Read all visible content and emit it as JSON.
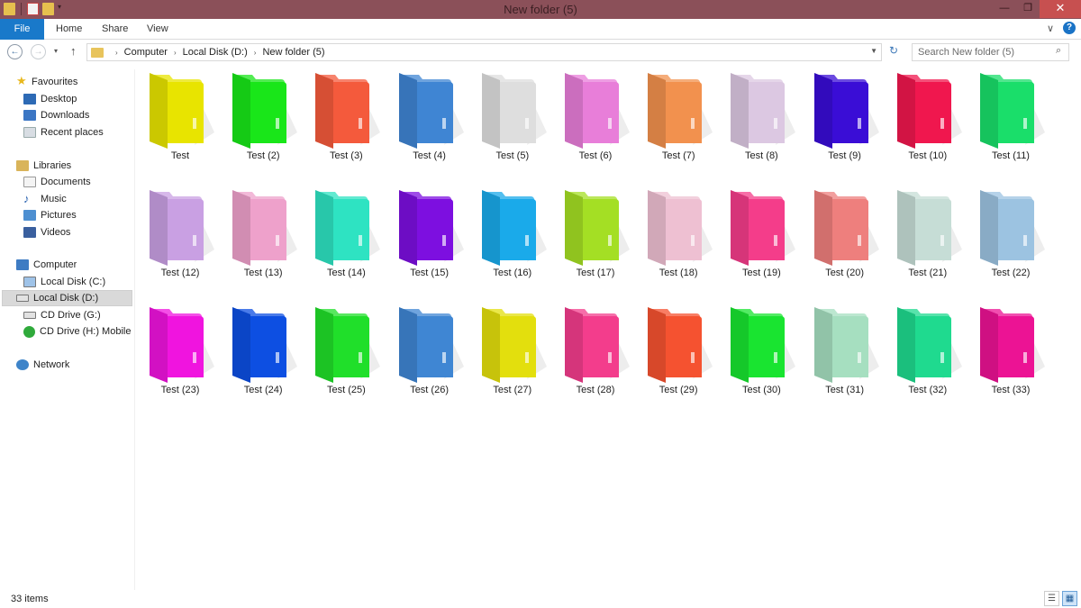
{
  "window": {
    "title": "New folder (5)",
    "minimize_glyph": "—",
    "restore_glyph": "❐",
    "close_glyph": "✕"
  },
  "ribbon": {
    "tabs": [
      "File",
      "Home",
      "Share",
      "View"
    ],
    "help_glyph": "?",
    "expand_glyph": "∨"
  },
  "address": {
    "back_glyph": "←",
    "forward_glyph": "→",
    "recent_glyph": "▾",
    "up_glyph": "↑",
    "crumbs": [
      "Computer",
      "Local Disk (D:)",
      "New folder (5)"
    ],
    "separator_glyph": "›",
    "dropdown_glyph": "⌵",
    "refresh_glyph": "↻"
  },
  "search": {
    "placeholder": "Search New folder (5)",
    "icon_glyph": "⌕"
  },
  "nav_pane": {
    "favourites": {
      "label": "Favourites",
      "items": [
        "Desktop",
        "Downloads",
        "Recent places"
      ]
    },
    "libraries": {
      "label": "Libraries",
      "items": [
        "Documents",
        "Music",
        "Pictures",
        "Videos"
      ]
    },
    "computer": {
      "label": "Computer",
      "items": [
        "Local Disk (C:)",
        "Local Disk (D:)",
        "CD Drive (G:)",
        "CD Drive (H:) Mobile P"
      ]
    },
    "network": {
      "label": "Network"
    },
    "selected": "Local Disk (D:)"
  },
  "folders": [
    {
      "name": "Test",
      "color": "#e8e400"
    },
    {
      "name": "Test (2)",
      "color": "#19e619"
    },
    {
      "name": "Test (3)",
      "color": "#f45a3c"
    },
    {
      "name": "Test (4)",
      "color": "#3f85d3"
    },
    {
      "name": "Test (5)",
      "color": "#dedede"
    },
    {
      "name": "Test (6)",
      "color": "#e87ed9"
    },
    {
      "name": "Test (7)",
      "color": "#f2914e"
    },
    {
      "name": "Test (8)",
      "color": "#dcc8e2"
    },
    {
      "name": "Test (9)",
      "color": "#3a0dd6"
    },
    {
      "name": "Test (10)",
      "color": "#f0174e"
    },
    {
      "name": "Test (11)",
      "color": "#1ade6a"
    },
    {
      "name": "Test (12)",
      "color": "#c9a0e3"
    },
    {
      "name": "Test (13)",
      "color": "#eea1cb"
    },
    {
      "name": "Test (14)",
      "color": "#2ee3c2"
    },
    {
      "name": "Test (15)",
      "color": "#7d0fe0"
    },
    {
      "name": "Test (16)",
      "color": "#1aaaea"
    },
    {
      "name": "Test (17)",
      "color": "#a4df24"
    },
    {
      "name": "Test (18)",
      "color": "#eec0d2"
    },
    {
      "name": "Test (19)",
      "color": "#f43d8a"
    },
    {
      "name": "Test (20)",
      "color": "#ee7f7d"
    },
    {
      "name": "Test (21)",
      "color": "#c6ddd6"
    },
    {
      "name": "Test (22)",
      "color": "#9cc3e1"
    },
    {
      "name": "Test (23)",
      "color": "#f014df"
    },
    {
      "name": "Test (24)",
      "color": "#0d4fe2"
    },
    {
      "name": "Test (25)",
      "color": "#20df2a"
    },
    {
      "name": "Test (26)",
      "color": "#3f86d3"
    },
    {
      "name": "Test (27)",
      "color": "#e3df0d"
    },
    {
      "name": "Test (28)",
      "color": "#f33d8c"
    },
    {
      "name": "Test (29)",
      "color": "#f55230"
    },
    {
      "name": "Test (30)",
      "color": "#19e430"
    },
    {
      "name": "Test (31)",
      "color": "#a6dfc0"
    },
    {
      "name": "Test (32)",
      "color": "#1fda8f"
    },
    {
      "name": "Test (33)",
      "color": "#ec1394"
    }
  ],
  "status": {
    "count": "33 items",
    "details_glyph": "☰",
    "icons_glyph": "▦"
  }
}
